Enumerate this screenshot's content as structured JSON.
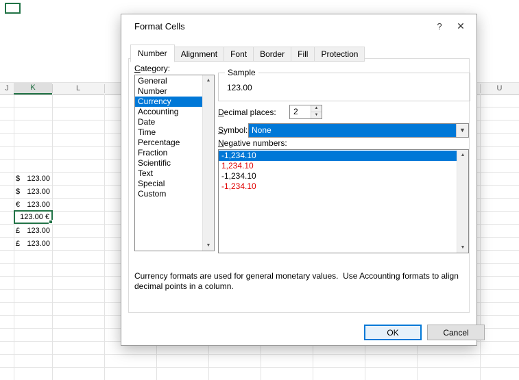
{
  "spreadsheet": {
    "columns": [
      "J",
      "K",
      "L",
      "U"
    ],
    "selected_column": "K",
    "cells": [
      {
        "sym": "$",
        "amt": "123.00"
      },
      {
        "sym": "$",
        "amt": "123.00"
      },
      {
        "sym": "€",
        "amt": "123.00"
      },
      {
        "sym": "",
        "amt": "123.00 €",
        "active": true
      },
      {
        "sym": "£",
        "amt": "123.00"
      },
      {
        "sym": "£",
        "amt": "123.00"
      }
    ]
  },
  "dialog": {
    "title": "Format Cells",
    "help_icon": "?",
    "close_icon": "✕",
    "tabs": [
      {
        "label": "Number",
        "active": true
      },
      {
        "label": "Alignment"
      },
      {
        "label": "Font"
      },
      {
        "label": "Border"
      },
      {
        "label": "Fill"
      },
      {
        "label": "Protection"
      }
    ],
    "category": {
      "label": "Category:",
      "selected": "Currency",
      "items": [
        "General",
        "Number",
        "Currency",
        "Accounting",
        "Date",
        "Time",
        "Percentage",
        "Fraction",
        "Scientific",
        "Text",
        "Special",
        "Custom"
      ]
    },
    "sample": {
      "label": "Sample",
      "value": "123.00"
    },
    "decimal": {
      "label": "Decimal places:",
      "value": "2",
      "up_icon": "▲",
      "down_icon": "▼"
    },
    "symbol": {
      "label": "Symbol:",
      "value": "None",
      "dropdown_icon": "▼"
    },
    "negative": {
      "label": "Negative numbers:",
      "items": [
        {
          "text": "-1,234.10",
          "style": "selected"
        },
        {
          "text": "1,234.10",
          "style": "red"
        },
        {
          "text": "-1,234.10",
          "style": "black"
        },
        {
          "text": "-1,234.10",
          "style": "red"
        }
      ]
    },
    "scrollbar": {
      "up": "▲",
      "down": "▼"
    },
    "description": "Currency formats are used for general monetary values.  Use Accounting formats to align decimal points in a column.",
    "buttons": {
      "ok": "OK",
      "cancel": "Cancel"
    }
  },
  "colors": {
    "accent": "#0078d7",
    "excel_green": "#217346",
    "negative_red": "#e00000"
  }
}
